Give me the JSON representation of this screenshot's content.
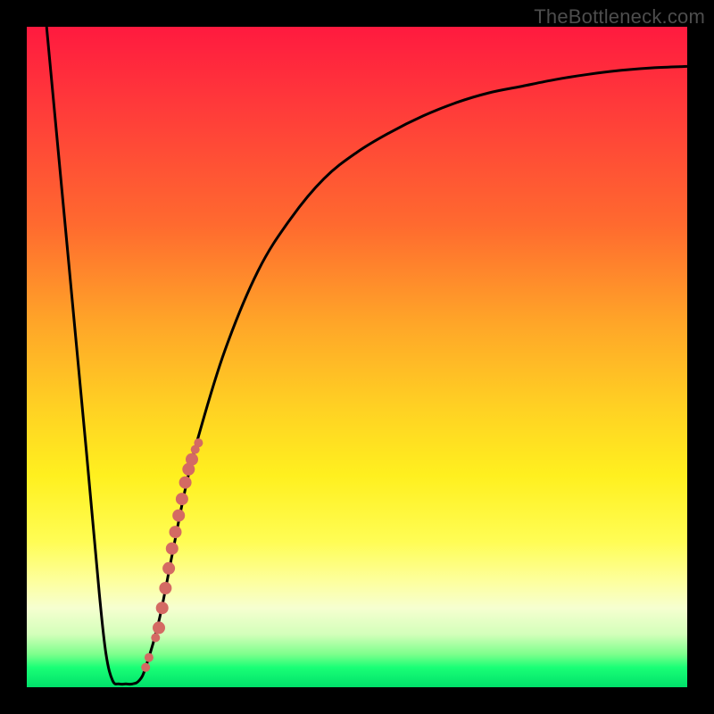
{
  "attribution": "TheBottleneck.com",
  "colors": {
    "frame": "#000000",
    "curve": "#000000",
    "marker": "#d46a63",
    "gradient_top": "#ff1a3f",
    "gradient_bottom": "#00e06a"
  },
  "chart_data": {
    "type": "line",
    "title": "",
    "xlabel": "",
    "ylabel": "",
    "xlim": [
      0,
      100
    ],
    "ylim": [
      0,
      100
    ],
    "grid": false,
    "legend": false,
    "series": [
      {
        "name": "bottleneck-curve",
        "x": [
          3,
          6,
          9,
          11,
          12,
          13,
          14,
          15,
          16,
          17,
          18,
          20,
          22,
          24,
          26,
          30,
          35,
          40,
          45,
          50,
          55,
          60,
          65,
          70,
          75,
          80,
          85,
          90,
          95,
          100
        ],
        "y": [
          100,
          68,
          36,
          14,
          5,
          1,
          0.5,
          0.5,
          0.5,
          1,
          3,
          10,
          20,
          30,
          38,
          51,
          63,
          71,
          77,
          81,
          84,
          86.5,
          88.5,
          90,
          91,
          92,
          92.8,
          93.4,
          93.8,
          94
        ]
      }
    ],
    "markers": {
      "name": "highlight-cluster",
      "x": [
        18.0,
        18.5,
        19.5,
        20.0,
        20.5,
        21.0,
        21.5,
        22.0,
        22.5,
        23.0,
        23.5,
        24.0,
        24.5,
        25.0,
        25.5,
        26.0
      ],
      "y": [
        3.0,
        4.5,
        7.5,
        9.0,
        12.0,
        15.0,
        18.0,
        21.0,
        23.5,
        26.0,
        28.5,
        31.0,
        33.0,
        34.5,
        36.0,
        37.0
      ]
    }
  }
}
